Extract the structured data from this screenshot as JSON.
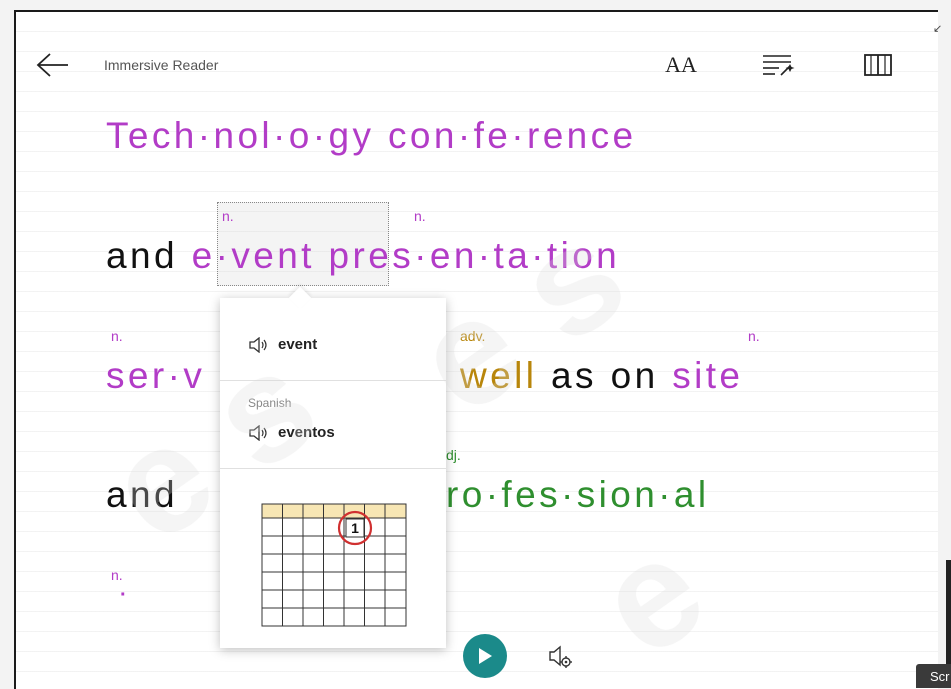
{
  "app": {
    "title": "Immersive Reader"
  },
  "toolbar": {
    "back": "back-arrow-icon",
    "text_prefs": "text-preferences-icon",
    "grammar": "grammar-options-icon",
    "reading": "reading-preferences-icon",
    "text_prefs_glyph": "AA"
  },
  "content": {
    "line1": "Tech·nol·o·gy con·fe·rence",
    "line2_a": "and",
    "line2_b": "e·vent",
    "line2_c": "pres·en·ta·tion",
    "line2_pos_event": "n.",
    "line2_pos_presentation": "n.",
    "line3_a": "ser·v",
    "line3_b": "well",
    "line3_c": "as on",
    "line3_d": "site",
    "line3_pos_service": "n.",
    "line3_pos_well": "adv.",
    "line3_pos_site": "n.",
    "line4_a": "and",
    "line4_b": "ro·fes·sion·al",
    "line4_pos": "dj.",
    "line5_pos": "n.",
    "line5_dot": "·"
  },
  "popup": {
    "word": "event",
    "language": "Spanish",
    "translation": "eventos",
    "calendar_day": "1"
  },
  "controls": {
    "play": "play-icon",
    "voice": "voice-settings-icon"
  },
  "screen": {
    "tab_label": "Scr"
  },
  "colors": {
    "noun": "#b23cc7",
    "adverb": "#b8860b",
    "adjective": "#2f8f2f",
    "play": "#1b8a8a"
  }
}
